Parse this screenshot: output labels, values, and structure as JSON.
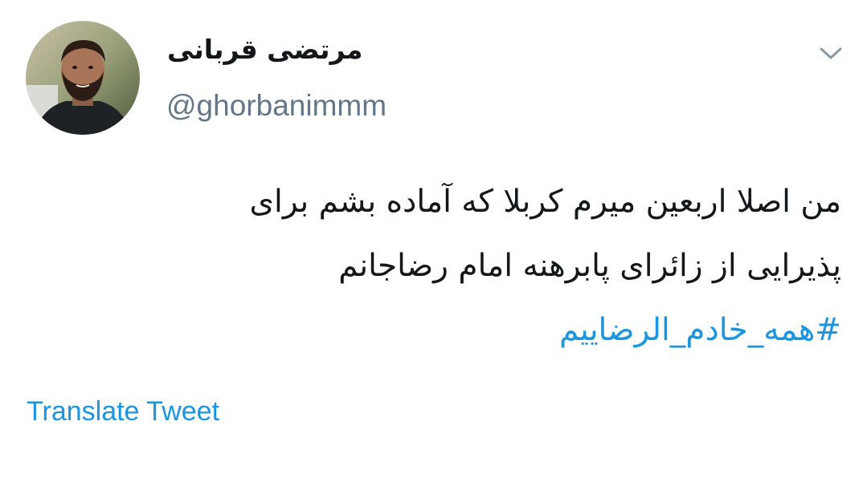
{
  "author": {
    "display_name": "مرتضی قربانی",
    "handle": "@ghorbanimmm",
    "avatar_icon": "user-avatar-photo"
  },
  "menu": {
    "icon": "chevron-down-icon"
  },
  "tweet": {
    "lines": [
      "من اصلا اربعین میرم کربلا که آماده بشم برای",
      "پذیرایی از زائرای پابرهنه امام رضاجانم"
    ],
    "hashtag": "#همه_خادم_الرضاییم"
  },
  "actions": {
    "translate_label": "Translate Tweet"
  },
  "colors": {
    "link": "#1b95e0",
    "text": "#14171a",
    "secondary": "#657786"
  }
}
